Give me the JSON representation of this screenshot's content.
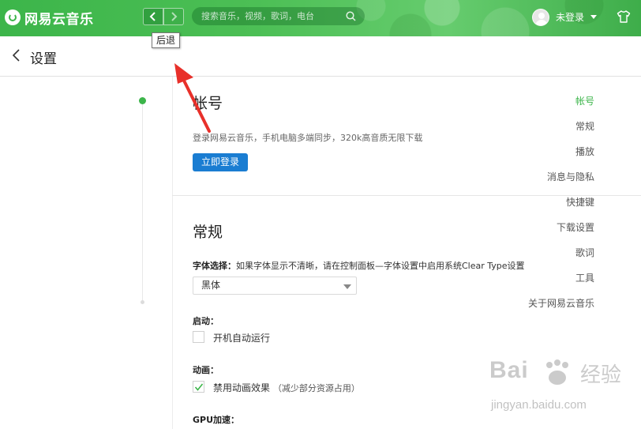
{
  "app": {
    "name": "网易云音乐",
    "search_placeholder": "搜索音乐，视频，歌词，电台",
    "user_name": "未登录",
    "back_tooltip": "后退"
  },
  "page": {
    "title": "设置"
  },
  "sidebar": {
    "items": [
      {
        "label": "帐号",
        "active": true
      },
      {
        "label": "常规",
        "active": false
      },
      {
        "label": "播放",
        "active": false
      },
      {
        "label": "消息与隐私",
        "active": false
      },
      {
        "label": "快捷键",
        "active": false
      },
      {
        "label": "下载设置",
        "active": false
      },
      {
        "label": "歌词",
        "active": false
      },
      {
        "label": "工具",
        "active": false
      },
      {
        "label": "关于网易云音乐",
        "active": false
      }
    ]
  },
  "account": {
    "heading": "帐号",
    "description": "登录网易云音乐，手机电脑多端同步，320k高音质无限下载",
    "login_button": "立即登录"
  },
  "general": {
    "heading": "常规",
    "font_label": "字体选择：",
    "font_hint": "如果字体显示不清晰，请在控制面板—字体设置中启用系统Clear Type设置",
    "font_value": "黑体",
    "startup_label": "启动：",
    "startup_option": "开机自动运行",
    "startup_checked": false,
    "animation_label": "动画：",
    "animation_option": "禁用动画效果",
    "animation_note": "（减少部分资源占用）",
    "animation_checked": true,
    "gpu_label": "GPU加速："
  },
  "watermark": {
    "brand": "Bai",
    "brand_cn": "经验",
    "url": "jingyan.baidu.com"
  },
  "colors": {
    "brand_green": "#3cb54a",
    "button_blue": "#1a7dd2",
    "annotation_red": "#e8302a"
  }
}
